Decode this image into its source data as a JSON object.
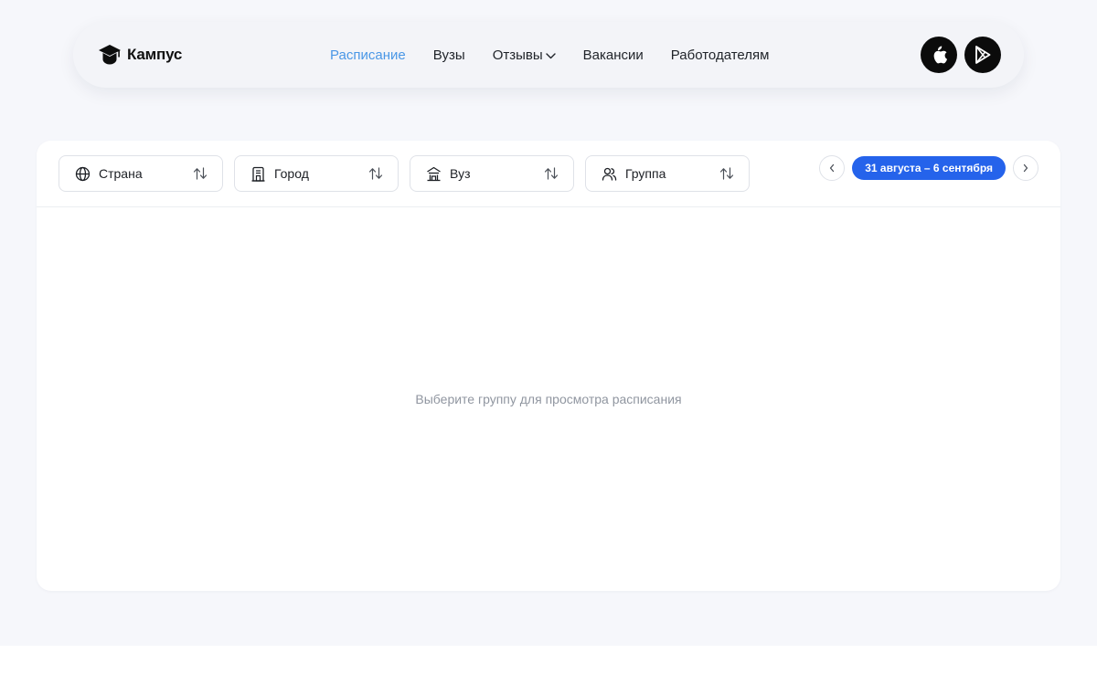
{
  "header": {
    "logo_text": "Кампус",
    "nav": [
      {
        "label": "Расписание",
        "active": true
      },
      {
        "label": "Вузы",
        "active": false
      },
      {
        "label": "Отзывы",
        "active": false,
        "has_dropdown": true
      },
      {
        "label": "Вакансии",
        "active": false
      },
      {
        "label": "Работодателям",
        "active": false
      }
    ],
    "store_buttons": [
      "apple-icon",
      "google-play-icon"
    ]
  },
  "filters": [
    {
      "label": "Страна",
      "icon": "globe-icon"
    },
    {
      "label": "Город",
      "icon": "building-icon"
    },
    {
      "label": "Вуз",
      "icon": "university-icon"
    },
    {
      "label": "Группа",
      "icon": "users-icon"
    }
  ],
  "week": {
    "range_label": "31 августа – 6 сентября"
  },
  "empty_state": {
    "message": "Выберите группу для просмотра расписания"
  },
  "colors": {
    "accent": "#2563eb",
    "nav_active": "#4a97e6",
    "page_bg": "#f6f7fb"
  }
}
